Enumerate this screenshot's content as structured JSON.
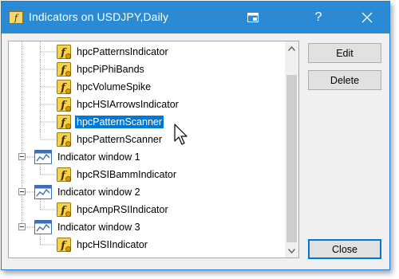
{
  "window": {
    "title": "Indicators on USDJPY,Daily",
    "title_icon": "indicators-app-icon",
    "help_label": "?",
    "titlebar_color": "#2a8ad4",
    "selection_color": "#0078d7"
  },
  "tree": {
    "items": [
      {
        "label": "hpcPatternsIndicator",
        "kind": "indicator",
        "icon": "indicator-f-icon",
        "selected": false
      },
      {
        "label": "hpcPiPhiBands",
        "kind": "indicator",
        "icon": "indicator-f-icon",
        "selected": false
      },
      {
        "label": "hpcVolumeSpike",
        "kind": "indicator",
        "icon": "indicator-f-icon",
        "selected": false
      },
      {
        "label": "hpcHSIArrowsIndicator",
        "kind": "indicator",
        "icon": "indicator-f-icon",
        "selected": false
      },
      {
        "label": "hpcPatternScanner",
        "kind": "indicator",
        "icon": "indicator-f-icon",
        "selected": true
      },
      {
        "label": "hpcPatternScanner",
        "kind": "indicator",
        "icon": "indicator-f-icon",
        "selected": false
      },
      {
        "label": "Indicator window 1",
        "kind": "window",
        "icon": "indicator-window-icon",
        "expanded": true
      },
      {
        "label": "hpcRSIBammIndicator",
        "kind": "indicator",
        "icon": "indicator-f-icon",
        "selected": false
      },
      {
        "label": "Indicator window 2",
        "kind": "window",
        "icon": "indicator-window-icon",
        "expanded": true
      },
      {
        "label": "hpcAmpRSIIndicator",
        "kind": "indicator",
        "icon": "indicator-f-icon",
        "selected": false
      },
      {
        "label": "Indicator window 3",
        "kind": "window",
        "icon": "indicator-window-icon",
        "expanded": true
      },
      {
        "label": "hpcHSIIndicator",
        "kind": "indicator",
        "icon": "indicator-f-icon",
        "selected": false
      }
    ]
  },
  "buttons": {
    "edit": "Edit",
    "delete": "Delete",
    "close": "Close"
  }
}
